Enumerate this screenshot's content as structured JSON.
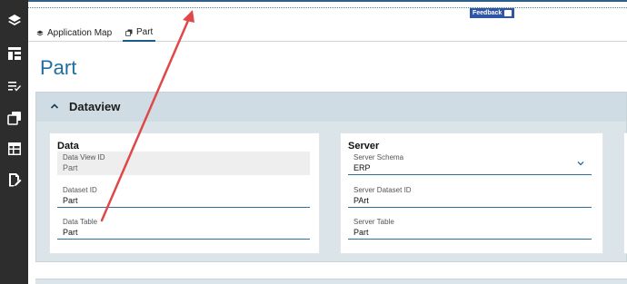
{
  "sidebar": {
    "icons": [
      {
        "name": "layers-icon"
      },
      {
        "name": "layout-icon"
      },
      {
        "name": "checklist-icon"
      },
      {
        "name": "copy-icon"
      },
      {
        "name": "table-icon"
      },
      {
        "name": "document-edit-icon"
      }
    ]
  },
  "feedback_label": "Feedback",
  "tabs": [
    {
      "label": "Application Map",
      "icon": "layers-icon"
    },
    {
      "label": "Part",
      "icon": "copy-icon",
      "active": true
    }
  ],
  "page": {
    "title": "Part"
  },
  "dataview": {
    "title": "Dataview",
    "data_card": {
      "title": "Data",
      "fields": [
        {
          "label": "Data View ID",
          "value": "Part",
          "readonly": true
        },
        {
          "label": "Dataset ID",
          "value": "Part"
        },
        {
          "label": "Data Table",
          "value": "Part"
        }
      ]
    },
    "server_card": {
      "title": "Server",
      "fields": [
        {
          "label": "Server Schema",
          "value": "ERP",
          "dropdown": true
        },
        {
          "label": "Server Dataset ID",
          "value": "PArt"
        },
        {
          "label": "Server Table",
          "value": "Part"
        }
      ]
    }
  },
  "colors": {
    "accent": "#1f6e9e",
    "rail": "#2d2d2d",
    "panel": "#dbe4e8",
    "annotation_arrow": "#e04848"
  }
}
